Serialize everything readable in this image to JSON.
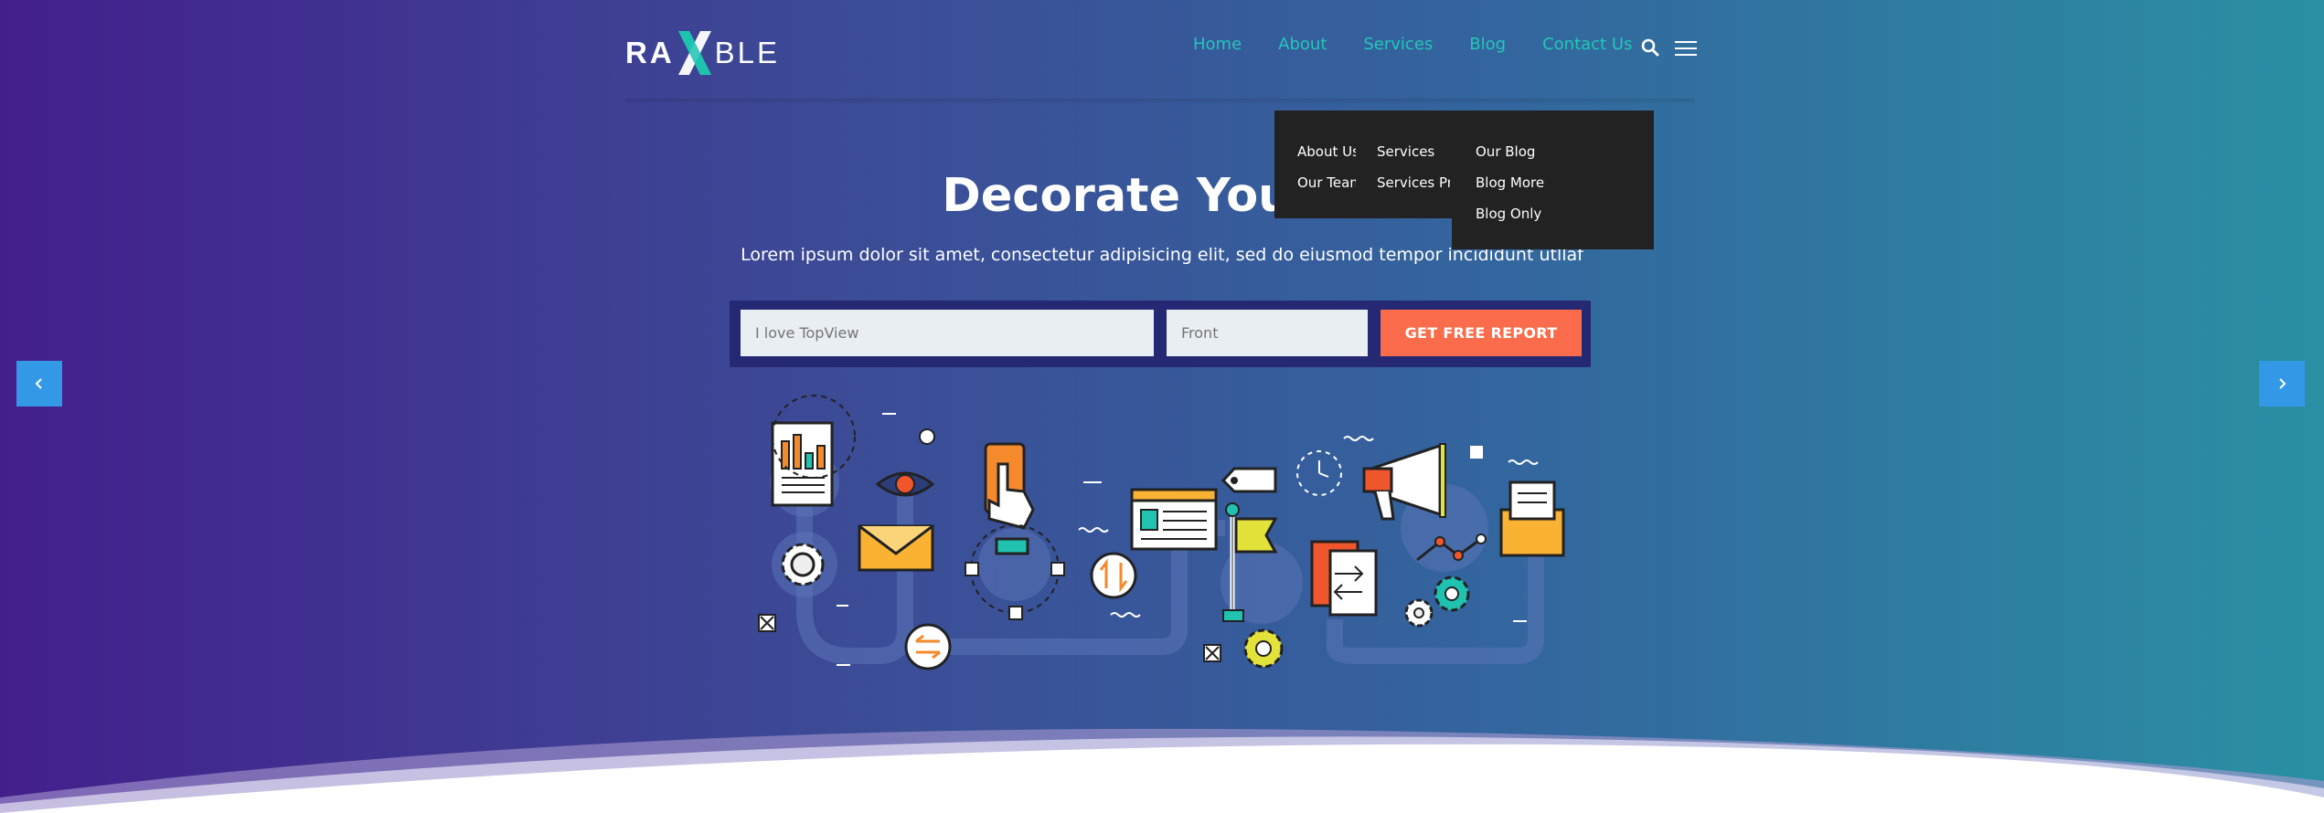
{
  "brand": {
    "logo_left": "RA",
    "logo_right": "BLE",
    "logo_text": "RAXBLE"
  },
  "nav": {
    "items": [
      "Home",
      "About",
      "Services",
      "Blog",
      "Contact Us"
    ]
  },
  "dropdown": {
    "col1": [
      "About Us",
      "Our Team"
    ],
    "col2": [
      "Services",
      "Services Pro"
    ],
    "col3": [
      "Our Blog",
      "Blog More",
      "Blog Only"
    ]
  },
  "hero": {
    "title": "Decorate Your W",
    "subtitle": "Lorem ipsum dolor sit amet, consectetur adipisicing elit, sed do eiusmod tempor incididunt utllaf"
  },
  "form": {
    "field1_placeholder": "I love TopView",
    "field2_placeholder": "Front",
    "submit_label": "GET FREE REPORT"
  },
  "colors": {
    "nav_accent": "#23c7b8",
    "cta": "#fa6c4c",
    "arrow_bg": "#3399e6",
    "dropdown_bg": "#222222"
  }
}
